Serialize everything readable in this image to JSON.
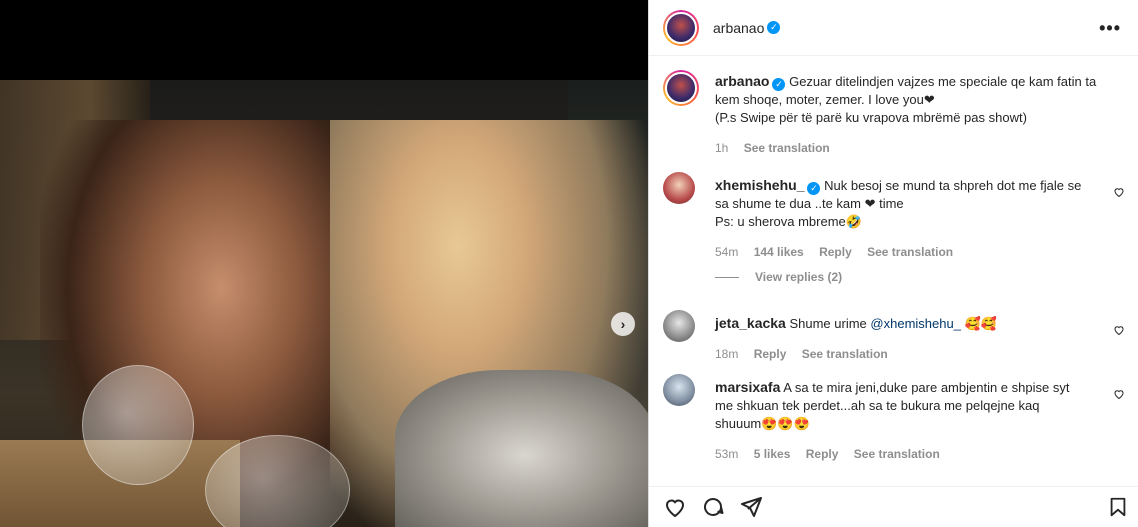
{
  "post": {
    "username": "arbanao",
    "caption_lines": [
      "Gezuar ditelindjen vajzes me speciale qe kam fatin ta",
      "kem shoqe, moter, zemer. I love you❤",
      "(P.s Swipe për të parë ku vrapova mbrëmë pas showt)"
    ],
    "time": "1h",
    "see_translation": "See translation"
  },
  "comments": [
    {
      "username": "xhemishehu_",
      "lines": [
        "Nuk besoj se mund ta shpreh dot me fjale se",
        "sa shume te dua ..te kam ❤ time",
        "Ps: u sherova mbreme🤣"
      ],
      "time": "54m",
      "likes": "144 likes",
      "reply": "Reply",
      "see_translation": "See translation",
      "view_replies": "View replies (2)"
    },
    {
      "username": "jeta_kacka",
      "text": "Shume urime",
      "mention": "@xhemishehu_",
      "emoji": "🥰🥰",
      "time": "18m",
      "reply": "Reply",
      "see_translation": "See translation"
    },
    {
      "username": "marsixafa",
      "lines": [
        "A sa te mira jeni,duke pare ambjentin e shpise syt",
        "me shkuan tek perdet...ah sa te bukura me pelqejne kaq",
        "shuuum😍😍😍"
      ],
      "time": "53m",
      "likes": "5 likes",
      "reply": "Reply",
      "see_translation": "See translation"
    }
  ],
  "icons": {
    "like": "heart-icon",
    "comment": "comment-icon",
    "share": "share-icon",
    "save": "bookmark-icon",
    "more": "more-icon",
    "next": "chevron-right-icon"
  }
}
